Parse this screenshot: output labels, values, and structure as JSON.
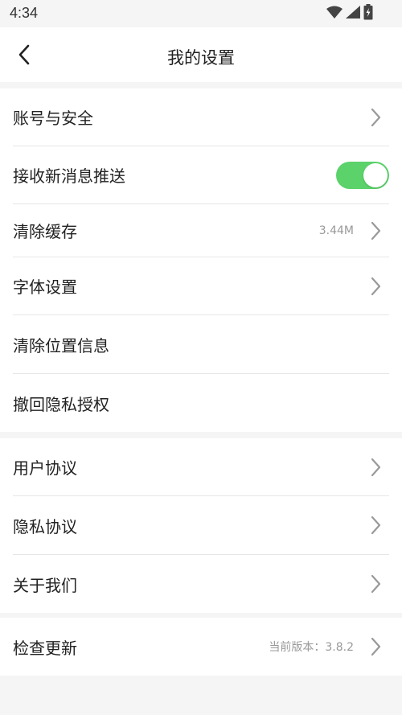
{
  "status_bar": {
    "time": "4:34",
    "icons": [
      "wifi-icon",
      "signal-icon",
      "battery-icon"
    ]
  },
  "header": {
    "title": "我的设置",
    "back_icon": "chevron-left-icon"
  },
  "groups": [
    {
      "items": [
        {
          "label": "账号与安全",
          "value": "",
          "control": "chevron"
        },
        {
          "label": "接收新消息推送",
          "value": "",
          "control": "toggle",
          "toggle_on": true
        },
        {
          "label": "清除缓存",
          "value": "3.44M",
          "control": "chevron"
        },
        {
          "label": "字体设置",
          "value": "",
          "control": "chevron"
        },
        {
          "label": "清除位置信息",
          "value": "",
          "control": "none"
        },
        {
          "label": "撤回隐私授权",
          "value": "",
          "control": "none"
        }
      ]
    },
    {
      "items": [
        {
          "label": "用户协议",
          "value": "",
          "control": "chevron"
        },
        {
          "label": "隐私协议",
          "value": "",
          "control": "chevron"
        },
        {
          "label": "关于我们",
          "value": "",
          "control": "chevron"
        }
      ]
    },
    {
      "items": [
        {
          "label": "检查更新",
          "value": "当前版本：3.8.2",
          "control": "chevron"
        }
      ]
    }
  ],
  "colors": {
    "toggle_on": "#5bd26a",
    "background": "#f5f5f5",
    "divider": "#e6e6e6",
    "chevron": "#999999"
  }
}
